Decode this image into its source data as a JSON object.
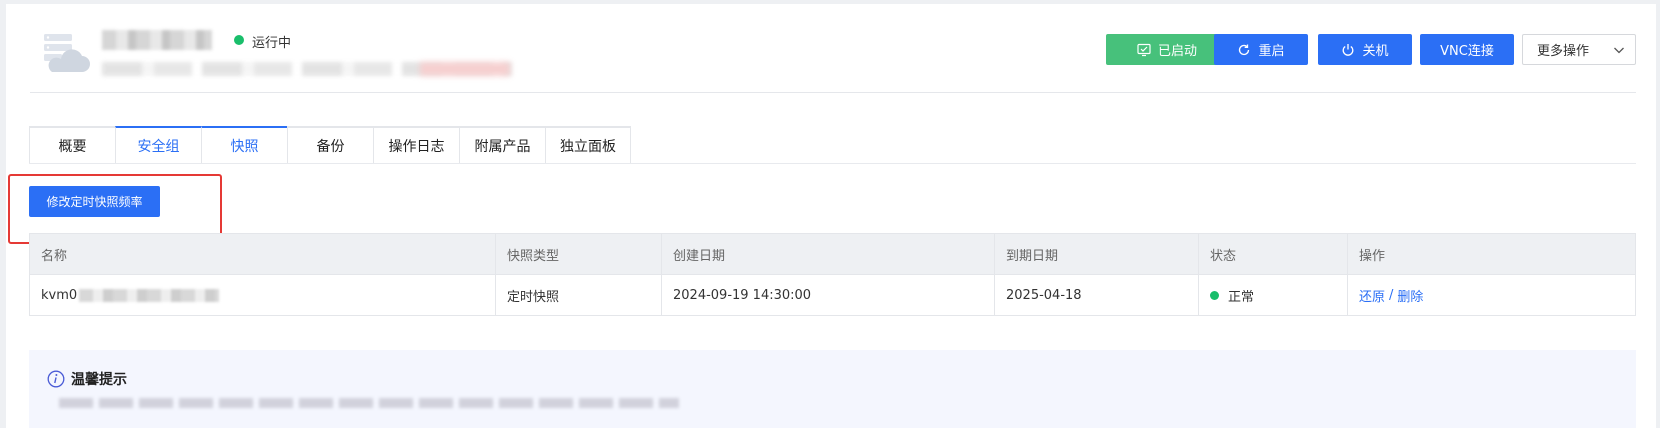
{
  "header": {
    "status": "运行中",
    "buttons": {
      "started": "已启动",
      "restart": "重启",
      "shutdown": "关机",
      "vnc": "VNC连接",
      "more": "更多操作"
    }
  },
  "tabs": [
    {
      "label": "概要"
    },
    {
      "label": "安全组"
    },
    {
      "label": "快照"
    },
    {
      "label": "备份"
    },
    {
      "label": "操作日志"
    },
    {
      "label": "附属产品"
    },
    {
      "label": "独立面板"
    }
  ],
  "toolbar": {
    "modify_label": "修改定时快照频率"
  },
  "table": {
    "headers": [
      "名称",
      "快照类型",
      "创建日期",
      "到期日期",
      "状态",
      "操作"
    ],
    "rows": [
      {
        "name_prefix": "kvm0",
        "type": "定时快照",
        "created": "2024-09-19 14:30:00",
        "expires": "2025-04-18",
        "status": "正常",
        "restore": "还原",
        "separator": "/",
        "delete": "删除"
      }
    ]
  },
  "tips": {
    "title": "温馨提示"
  },
  "colors": {
    "primary": "#2b6ff5",
    "success": "#47c17b",
    "status_green": "#19be6b",
    "highlight": "#e53935"
  }
}
